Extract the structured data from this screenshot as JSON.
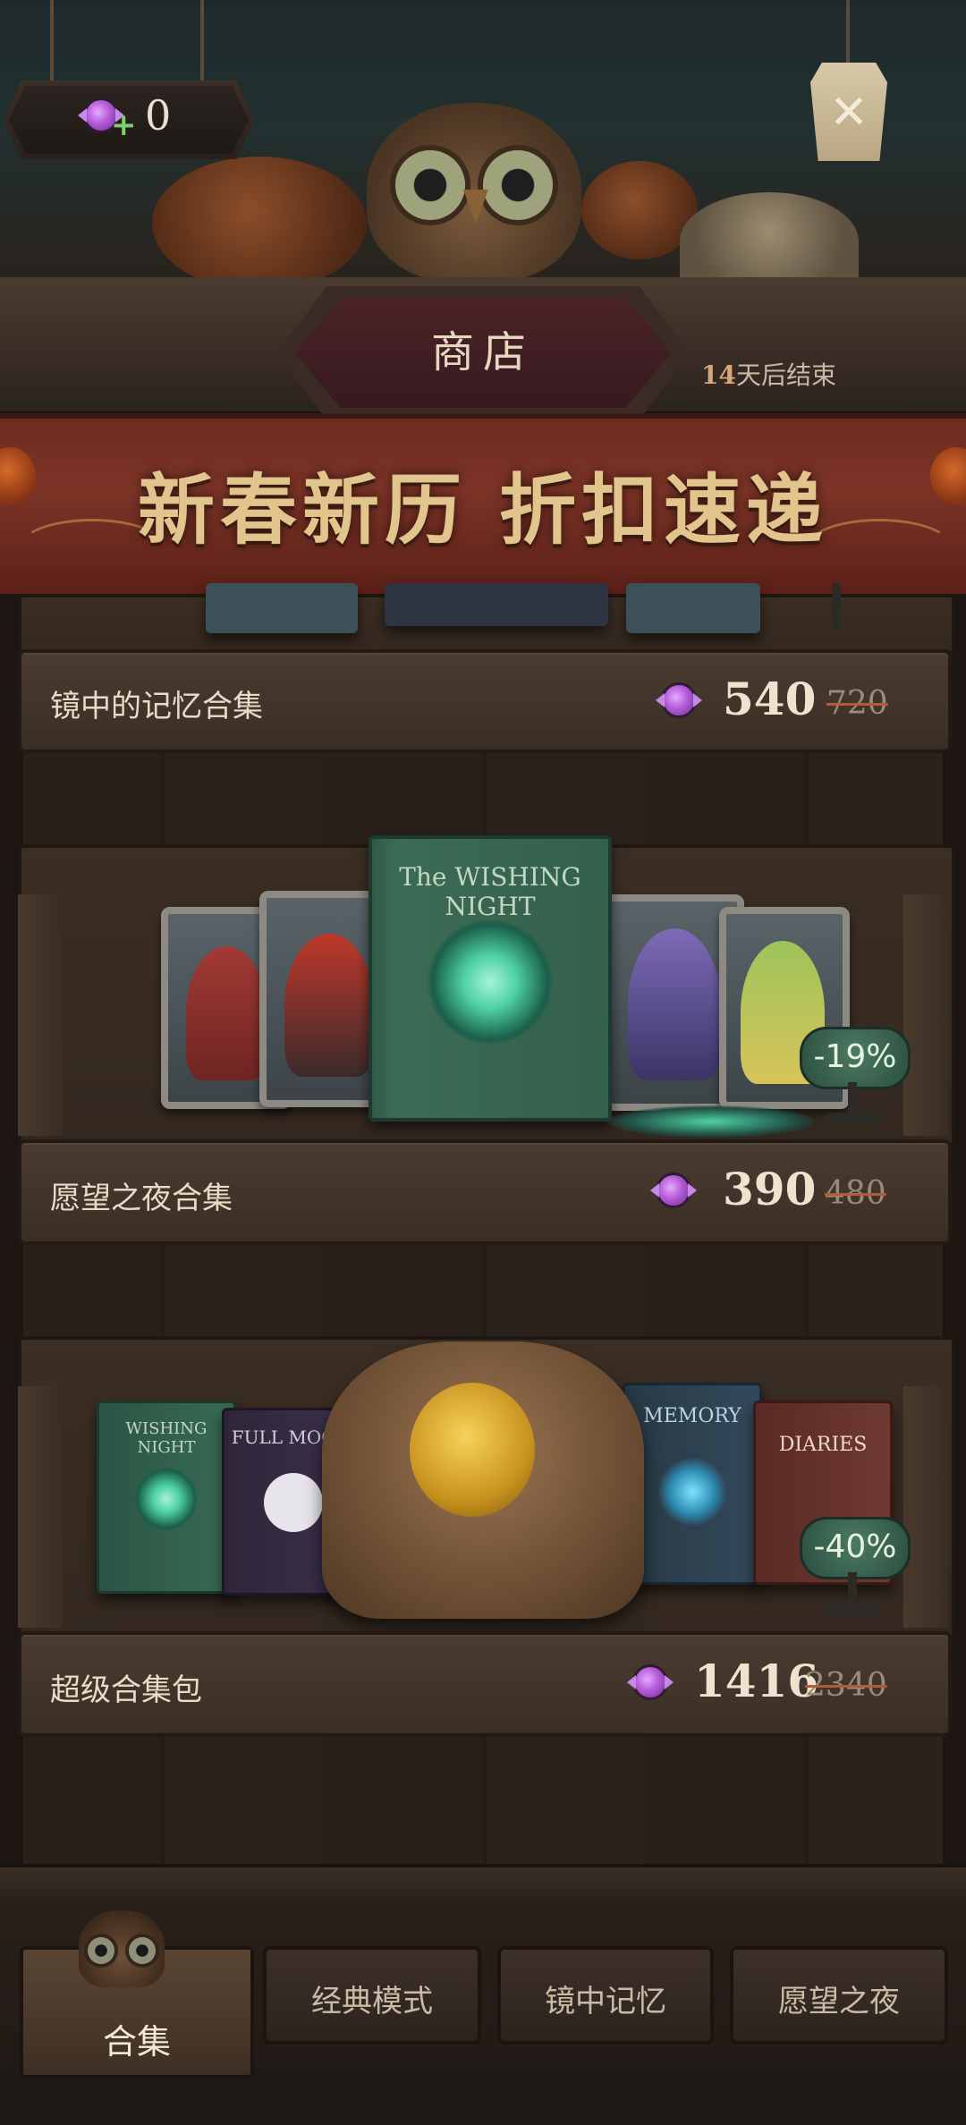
{
  "currency": {
    "count": "0",
    "icon": "candy-icon",
    "plus_icon": "plus-icon"
  },
  "header": {
    "title": "商店",
    "countdown_days": "14",
    "countdown_suffix": "天后结束",
    "close_icon": "close-icon"
  },
  "banner": {
    "text": "新春新历 折扣速递"
  },
  "bundles": [
    {
      "name": "镜中的记忆合集",
      "price": "540",
      "original_price": "720"
    },
    {
      "name": "愿望之夜合集",
      "price": "390",
      "original_price": "480",
      "discount": "-19%",
      "book_title": "The WISHING NIGHT"
    },
    {
      "name": "超级合集包",
      "price": "1416",
      "original_price": "2340",
      "discount": "-40%",
      "book_titles": [
        "WISHING NIGHT",
        "FULL MOON",
        "MEMORY",
        "DIARIES"
      ]
    }
  ],
  "tabs": [
    {
      "label": "合集",
      "active": true
    },
    {
      "label": "经典模式",
      "active": false
    },
    {
      "label": "镜中记忆",
      "active": false
    },
    {
      "label": "愿望之夜",
      "active": false
    }
  ],
  "colors": {
    "banner": "#7c3426",
    "gold_text": "#e2c48d",
    "discount_green": "#4c7a63",
    "candy": "#b45ad8"
  }
}
